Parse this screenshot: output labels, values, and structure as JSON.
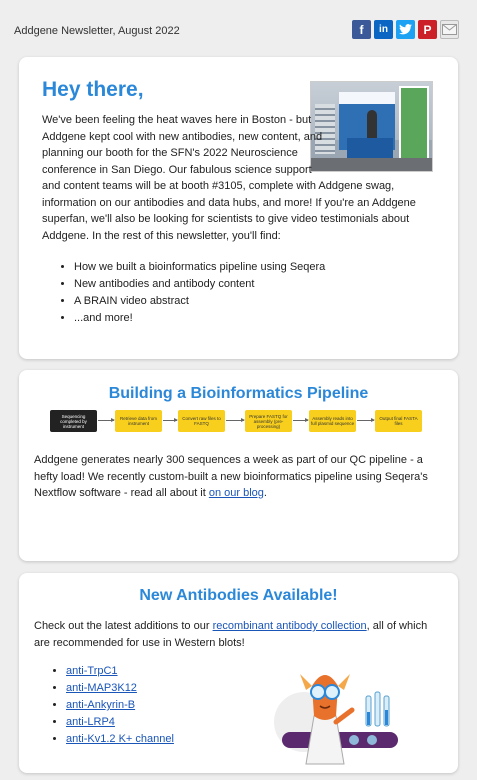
{
  "header": {
    "title": "Addgene Newsletter, August 2022",
    "share_icons": [
      "facebook-icon",
      "linkedin-icon",
      "twitter-icon",
      "pinterest-icon",
      "email-icon"
    ]
  },
  "intro": {
    "greeting": "Hey there,",
    "body": "We've been feeling the heat waves here in Boston - but Addgene kept cool with new antibodies, new content, and planning our booth for the SFN's 2022 Neuroscience conference in San Diego. Our fabulous science support and content teams will be at booth #3105, complete with Addgene swag, information on our antibodies and data hubs, and more! If you're an Addgene superfan, we'll also be looking for scientists to give video testimonials about Addgene. In the rest of this newsletter, you'll find:",
    "list": [
      "How we built a bioinformatics pipeline using Seqera",
      "New antibodies and antibody content",
      "A BRAIN video abstract",
      "...and more!"
    ]
  },
  "pipeline": {
    "heading": "Building a Bioinformatics Pipeline",
    "steps": [
      "Sequencing completed by instrument",
      "Retrieve data from instrument",
      "Convert raw files to FASTQ",
      "Prepare FASTQ for assembly (pre-processing)",
      "Assembly reads into full plasmid sequence",
      "Output final FASTA files"
    ],
    "body_before": "Addgene generates nearly 300 sequences a week as part of our QC pipeline - a hefty load! We recently custom-built a new bioinformatics pipeline using Seqera's Nextflow software - read all about it ",
    "link": "on our blog",
    "body_after": "."
  },
  "antibodies": {
    "heading": "New Antibodies Available!",
    "body_before": "Check out the latest additions to our ",
    "link": "recombinant antibody collection",
    "body_after": ", all of which are recommended for use in Western blots!",
    "list": [
      "anti-TrpC1",
      "anti-MAP3K12",
      "anti-Ankyrin-B",
      "anti-LRP4",
      "anti-Kv1.2 K+ channel"
    ]
  },
  "colors": {
    "accent": "#2b88d8",
    "link": "#1a55b8",
    "pipeline_step": "#f8cf1c"
  }
}
